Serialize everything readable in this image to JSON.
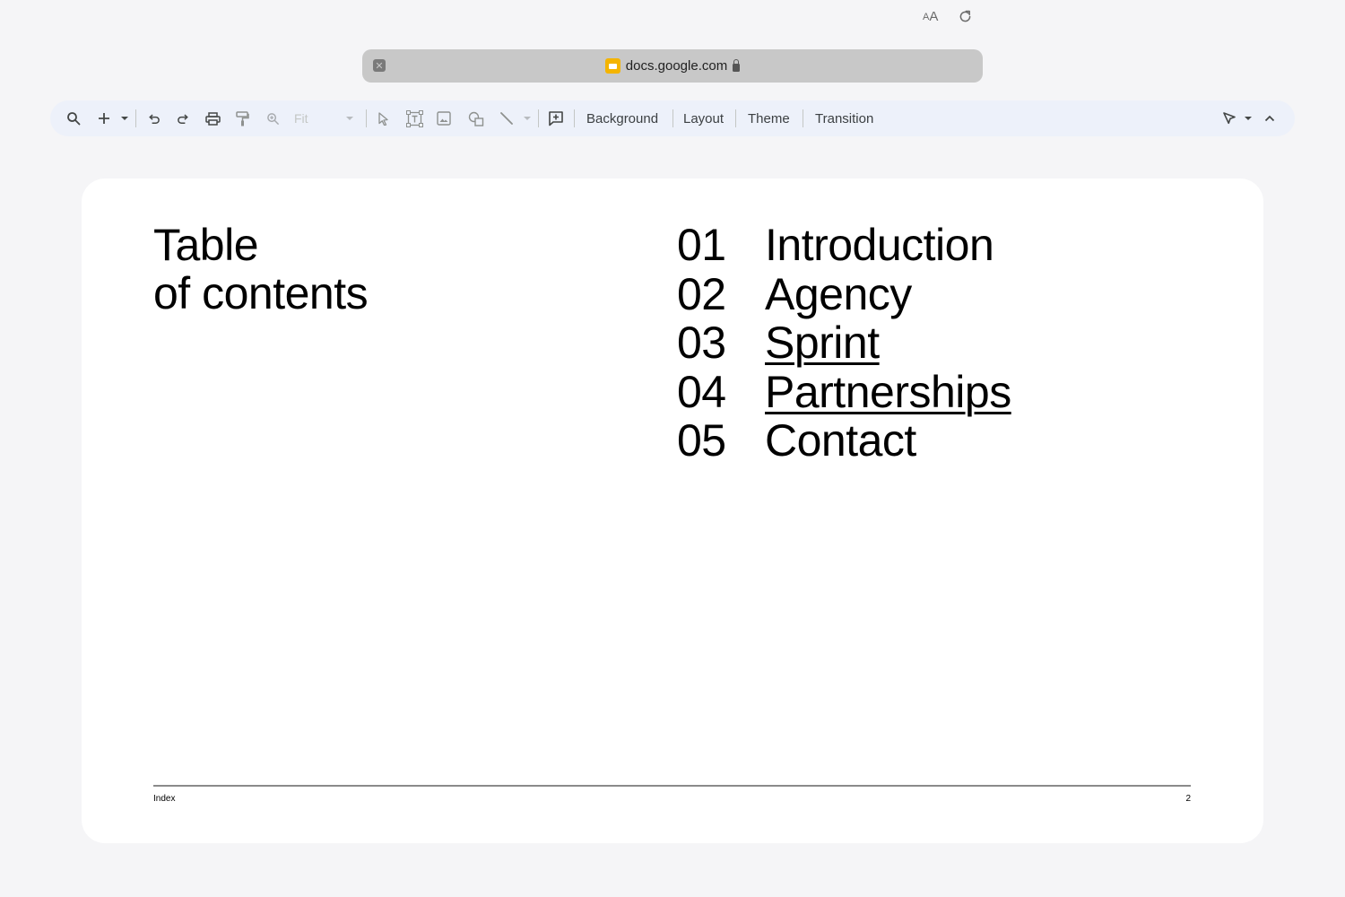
{
  "browser": {
    "url": "docs.google.com",
    "text_size_label_small": "A",
    "text_size_label_large": "A"
  },
  "toolbar": {
    "zoom_label": "Fit",
    "background_label": "Background",
    "layout_label": "Layout",
    "theme_label": "Theme",
    "transition_label": "Transition"
  },
  "slide": {
    "title_line1": "Table",
    "title_line2": "of contents",
    "items": [
      {
        "num": "01",
        "label": "Introduction",
        "link": false
      },
      {
        "num": "02",
        "label": "Agency",
        "link": false
      },
      {
        "num": "03",
        "label": "Sprint",
        "link": true
      },
      {
        "num": "04",
        "label": "Partnerships",
        "link": true
      },
      {
        "num": "05",
        "label": "Contact",
        "link": false
      }
    ],
    "footer_left": "Index",
    "footer_right": "2"
  },
  "colors": {
    "page_bg": "#f5f5f7",
    "toolbar_bg": "#edf1fa",
    "addressbar_bg": "#c8c8c8",
    "slides_brand": "#f4b400"
  }
}
